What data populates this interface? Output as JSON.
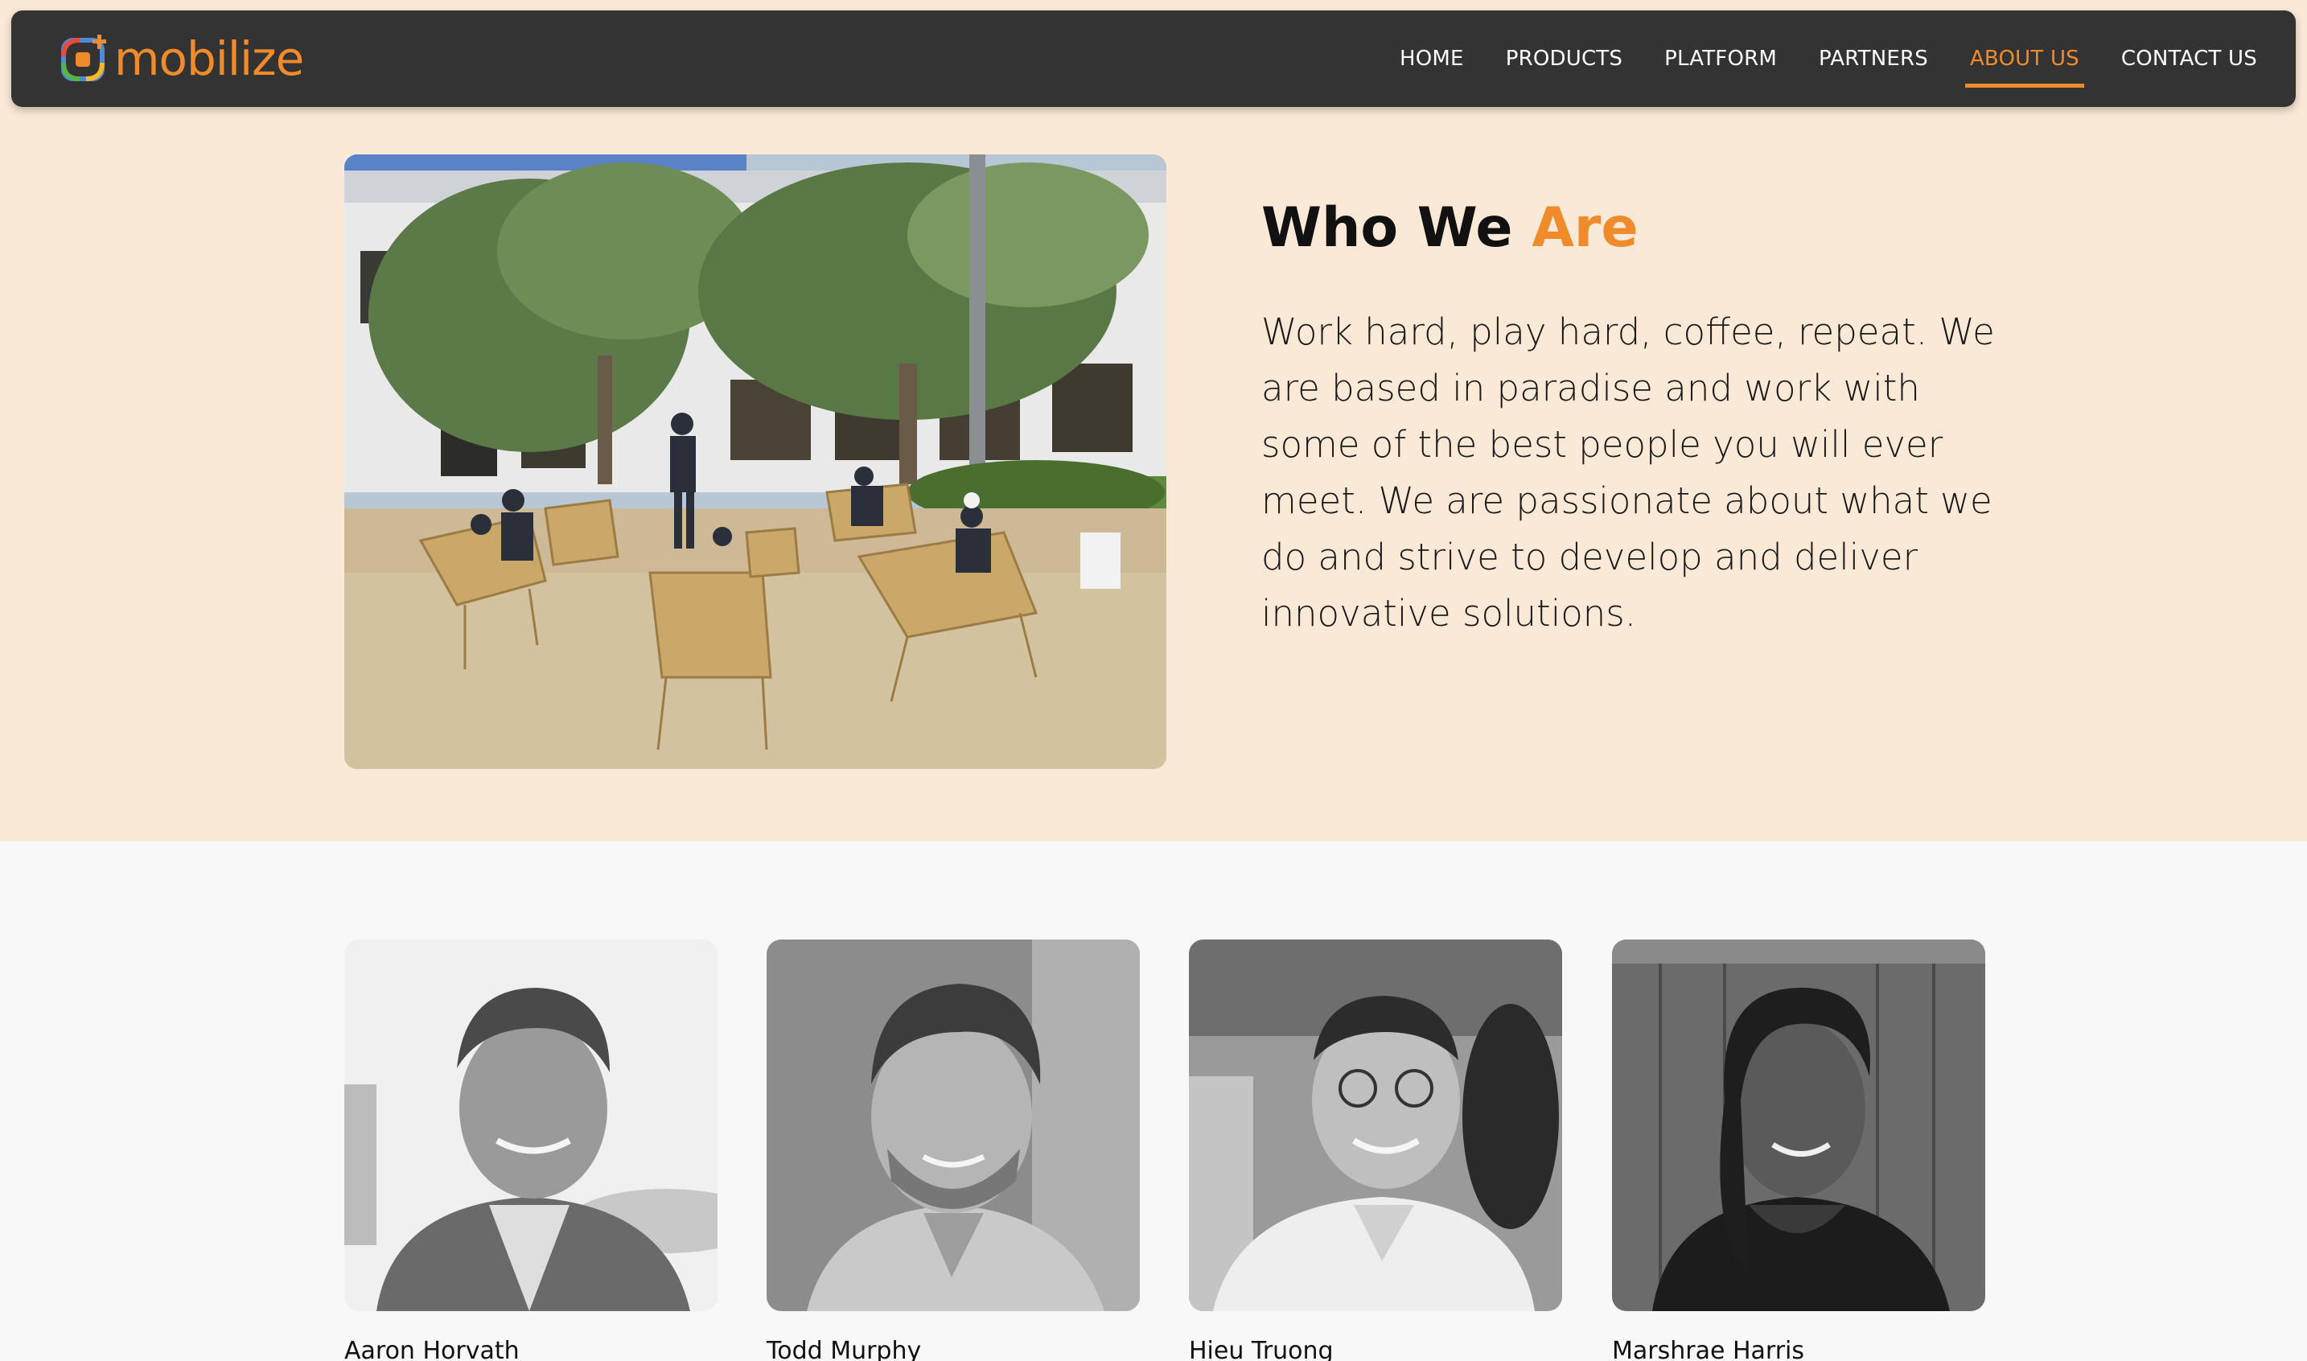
{
  "brand": {
    "name": "mobilize",
    "accent_color": "#ef8b2b",
    "nav_bg": "#333333",
    "hero_bg": "#fbe9d7"
  },
  "nav": {
    "items": [
      {
        "label": "HOME",
        "active": false
      },
      {
        "label": "PRODUCTS",
        "active": false
      },
      {
        "label": "PLATFORM",
        "active": false
      },
      {
        "label": "PARTNERS",
        "active": false
      },
      {
        "label": "ABOUT US",
        "active": true
      },
      {
        "label": "CONTACT US",
        "active": false
      }
    ]
  },
  "hero": {
    "title_prefix": "Who We ",
    "title_accent": "Are",
    "body": "Work hard, play hard, coffee, repeat. We are based in paradise and work with some of the best people you will ever meet. We are passionate about what we do and strive to develop and deliver innovative solutions."
  },
  "team": {
    "members": [
      {
        "name": "Aaron Horvath"
      },
      {
        "name": "Todd Murphy"
      },
      {
        "name": "Hieu Truong"
      },
      {
        "name": "Marshrae Harris"
      }
    ]
  }
}
